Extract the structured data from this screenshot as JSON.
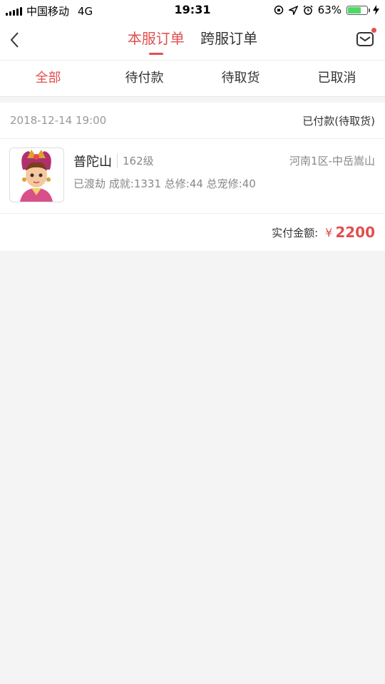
{
  "status_bar": {
    "carrier": "中国移动",
    "network": "4G",
    "time": "19:31",
    "battery_percent": "63%",
    "battery_level": 0.63
  },
  "nav": {
    "tabs": [
      {
        "label": "本服订单",
        "active": true
      },
      {
        "label": "跨服订单",
        "active": false
      }
    ]
  },
  "filters": [
    {
      "label": "全部",
      "active": true
    },
    {
      "label": "待付款",
      "active": false
    },
    {
      "label": "待取货",
      "active": false
    },
    {
      "label": "已取消",
      "active": false
    }
  ],
  "order": {
    "date": "2018-12-14 19:00",
    "status": "已付款(待取货)",
    "character_name": "普陀山",
    "level": "162级",
    "server": "河南1区-中岳嵩山",
    "detail": "已渡劫 成就:1331 总修:44 总宠修:40",
    "pay_label": "实付金额:",
    "currency": "¥",
    "amount": "2200"
  },
  "colors": {
    "accent": "#e0504f",
    "battery": "#4cd964"
  }
}
